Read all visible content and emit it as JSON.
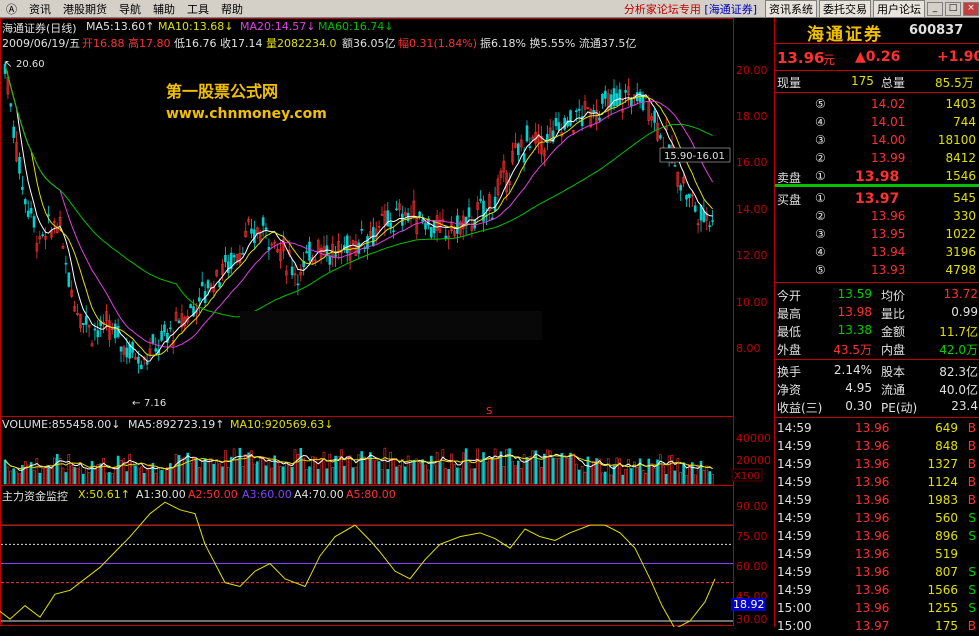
{
  "menu": {
    "items": [
      "Ⓐ",
      "资讯",
      "港股期货",
      "导航",
      "辅助",
      "工具",
      "帮助"
    ],
    "banner_red": "分析家论坛专用",
    "banner_blue": "[海通证券]",
    "buttons": [
      "资讯系统",
      "委托交易",
      "用户论坛"
    ],
    "win_buttons": [
      "_",
      "□",
      "×"
    ]
  },
  "header": {
    "stock_line": "海通证券(日线)",
    "ma5": "MA5:13.60↑",
    "ma10": "MA10:13.68↓",
    "ma20": "MA20:14.57↓",
    "ma60": "MA60:16.74↓",
    "info_date": "2009/06/19/五",
    "info_open": "开16.88",
    "info_high": "高17.80",
    "info_low": "低16.76",
    "info_close": "收17.14",
    "info_vol": "量2082234.0",
    "info_amt": "额36.05亿",
    "info_chg": "幅0.31(1.84%)",
    "info_rest": "振6.18% 换5.55% 流通37.5亿"
  },
  "watermark": {
    "title": "第一股票公式网",
    "url": "www.chnmoney.com"
  },
  "price_chart": {
    "axis_labels": [
      "20.00",
      "18.00",
      "16.00",
      "14.00",
      "12.00",
      "10.00",
      "8.00"
    ],
    "high_marker": "20.60",
    "low_marker": "7.16",
    "range_box": "15.90-16.01",
    "s_marker": "S"
  },
  "volume": {
    "label": "VOLUME:855458.00↓",
    "ma5": "MA5:892723.19↑",
    "ma10": "MA10:920569.63↓",
    "axis_labels": [
      "40000",
      "20000"
    ],
    "unit": "X100"
  },
  "indicator": {
    "name": "主力资金监控",
    "x": "X:50.61↑",
    "a1": "A1:30.00",
    "a2": "A2:50.00",
    "a3": "A3:60.00",
    "a4": "A4:70.00",
    "a5": "A5:80.00",
    "axis_labels": [
      "90.00",
      "75.00",
      "60.00",
      "45.00",
      "30.00"
    ],
    "current": "18.92"
  },
  "quote": {
    "logo": "海通证券",
    "code": "600837",
    "price": "13.96",
    "price_unit": "元",
    "change": "▲0.26",
    "change_pct": "+1.90",
    "cur_vol_label": "现量",
    "cur_vol": "175",
    "total_vol_label": "总量",
    "total_vol": "85.5万",
    "sells": [
      {
        "n": "⑤",
        "p": "14.02",
        "v": "1403"
      },
      {
        "n": "④",
        "p": "14.01",
        "v": "744"
      },
      {
        "n": "③",
        "p": "14.00",
        "v": "18100"
      },
      {
        "n": "②",
        "p": "13.99",
        "v": "8412"
      },
      {
        "n": "①",
        "p": "13.98",
        "v": "1546",
        "label": "卖盘"
      }
    ],
    "buys": [
      {
        "n": "①",
        "p": "13.97",
        "v": "545",
        "label": "买盘"
      },
      {
        "n": "②",
        "p": "13.96",
        "v": "330"
      },
      {
        "n": "③",
        "p": "13.95",
        "v": "1022"
      },
      {
        "n": "④",
        "p": "13.94",
        "v": "3196"
      },
      {
        "n": "⑤",
        "p": "13.93",
        "v": "4798"
      }
    ],
    "stats": [
      {
        "l1": "今开",
        "v1": "13.59",
        "c1": "#00d000",
        "l2": "均价",
        "v2": "13.72",
        "c2": "#ff3030"
      },
      {
        "l1": "最高",
        "v1": "13.98",
        "c1": "#ff3030",
        "l2": "量比",
        "v2": "0.99",
        "c2": "#e0e0e0"
      },
      {
        "l1": "最低",
        "v1": "13.38",
        "c1": "#00d000",
        "l2": "金额",
        "v2": "11.7亿",
        "c2": "#e0e000"
      },
      {
        "l1": "外盘",
        "v1": "43.5万",
        "c1": "#ff3030",
        "l2": "内盘",
        "v2": "42.0万",
        "c2": "#00d000"
      }
    ],
    "fund": [
      {
        "l1": "换手",
        "v1": "2.14%",
        "l2": "股本",
        "v2": "82.3亿"
      },
      {
        "l1": "净资",
        "v1": "4.95",
        "l2": "流通",
        "v2": "40.0亿"
      },
      {
        "l1": "收益(三)",
        "v1": "0.30",
        "l2": "PE(动)",
        "v2": "23.4"
      }
    ],
    "ticks": [
      {
        "t": "14:59",
        "p": "13.96",
        "v": "649",
        "s": "B"
      },
      {
        "t": "14:59",
        "p": "13.96",
        "v": "848",
        "s": "B"
      },
      {
        "t": "14:59",
        "p": "13.96",
        "v": "1327",
        "s": "B"
      },
      {
        "t": "14:59",
        "p": "13.96",
        "v": "1124",
        "s": "B"
      },
      {
        "t": "14:59",
        "p": "13.96",
        "v": "1983",
        "s": "B"
      },
      {
        "t": "14:59",
        "p": "13.96",
        "v": "560",
        "s": "S"
      },
      {
        "t": "14:59",
        "p": "13.96",
        "v": "896",
        "s": "S"
      },
      {
        "t": "14:59",
        "p": "13.96",
        "v": "519",
        "s": ""
      },
      {
        "t": "14:59",
        "p": "13.96",
        "v": "807",
        "s": "S"
      },
      {
        "t": "14:59",
        "p": "13.96",
        "v": "1566",
        "s": "S"
      },
      {
        "t": "15:00",
        "p": "13.96",
        "v": "1255",
        "s": "S"
      },
      {
        "t": "15:00",
        "p": "13.97",
        "v": "175",
        "s": "B"
      }
    ]
  },
  "colors": {
    "up": "#ff3030",
    "down": "#00d0d0",
    "ma5": "#ffffff",
    "ma10": "#e0e000",
    "ma20": "#e040e0",
    "ma60": "#00c000"
  }
}
